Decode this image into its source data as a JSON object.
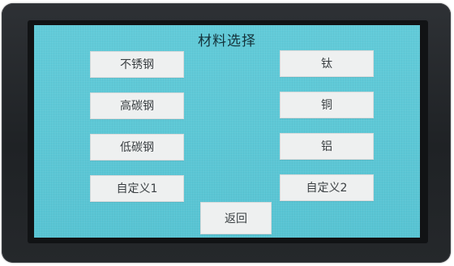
{
  "screen": {
    "title": "材料选择"
  },
  "buttons": {
    "stainless_steel": "不锈钢",
    "high_carbon_steel": "高碳钢",
    "low_carbon_steel": "低碳钢",
    "custom_1": "自定义1",
    "titanium": "钛",
    "copper": "铜",
    "aluminum": "铝",
    "custom_2": "自定义2",
    "back": "返回"
  },
  "colors": {
    "screen_background": "#5ec9d8",
    "button_background": "#eef0f0",
    "bezel": "#25282b"
  }
}
